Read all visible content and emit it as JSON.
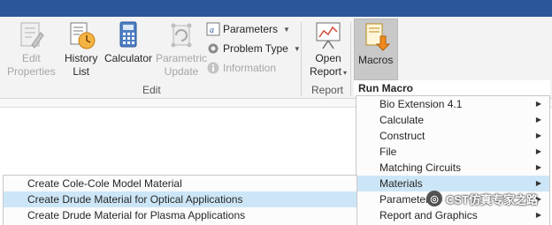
{
  "ribbon": {
    "buttons": {
      "edit_properties": "Edit\nProperties",
      "history_list": "History\nList",
      "calculator": "Calculator",
      "parametric_update": "Parametric\nUpdate",
      "open_report": "Open\nReport",
      "macros": "Macros"
    },
    "small": {
      "parameters": "Parameters",
      "problem_type": "Problem Type",
      "information": "Information"
    },
    "groups": {
      "edit": "Edit",
      "report": "Report"
    }
  },
  "menu": {
    "title": "Run Macro",
    "items": [
      "Bio Extension 4.1",
      "Calculate",
      "Construct",
      "File",
      "Matching Circuits",
      "Materials",
      "Parameter",
      "Report and Graphics"
    ],
    "highlighted_index": 5
  },
  "submenu": {
    "items": [
      "Create Cole-Cole Model Material",
      "Create Drude Material for Optical Applications",
      "Create Drude Material for Plasma Applications"
    ],
    "highlighted_index": 1
  },
  "watermark": "CST仿真专家之路",
  "colors": {
    "title_bar": "#2b579a",
    "highlight": "#cde6f7",
    "ribbon_bg": "#f3f3f3"
  }
}
